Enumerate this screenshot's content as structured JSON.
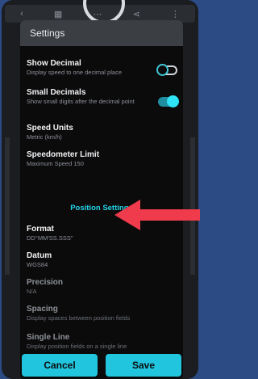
{
  "dialog": {
    "title": "Settings"
  },
  "settings": [
    {
      "title": "Show Decimal",
      "subtitle": "Display speed to one decimal place"
    },
    {
      "title": "Small Decimals",
      "subtitle": "Show small digits after the decimal point"
    },
    {
      "title": "Speed Units",
      "subtitle": "Metric (km/h)"
    },
    {
      "title": "Speedometer Limit",
      "subtitle": "Maximum Speed 150"
    }
  ],
  "toggles": {
    "show_decimal": "off",
    "small_decimals": "on"
  },
  "section": {
    "title": "Position Settings"
  },
  "position_settings": [
    {
      "title": "Format",
      "subtitle": "DD°MM'SS.SSS\""
    },
    {
      "title": "Datum",
      "subtitle": "WGS84"
    },
    {
      "title": "Precision",
      "subtitle": "N/A"
    },
    {
      "title": "Spacing",
      "subtitle": "Display spaces between position fields"
    },
    {
      "title": "Single Line",
      "subtitle": "Display position fields on a single line"
    }
  ],
  "buttons": {
    "cancel": "Cancel",
    "save": "Save"
  },
  "colors": {
    "accent": "#22c5de",
    "arrow": "#ef3b4b",
    "background": "#2c4b85"
  },
  "icons": [
    "more-vert-icon",
    "share-icon",
    "camera-notch"
  ]
}
